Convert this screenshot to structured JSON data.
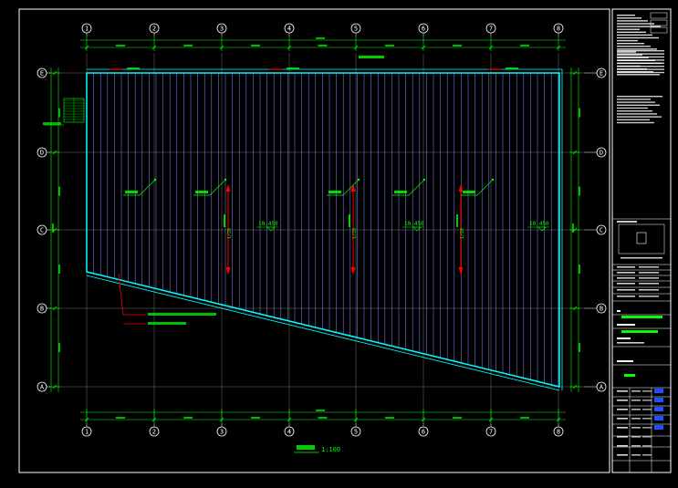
{
  "drawing": {
    "grid_columns": [
      "1",
      "2",
      "3",
      "4",
      "5",
      "6",
      "7",
      "8"
    ],
    "grid_rows": [
      "E",
      "D",
      "C",
      "B",
      "A"
    ],
    "elevations": [
      "10.450",
      "10.450",
      "10.450"
    ],
    "scale": "1:100",
    "slope_label": "1/20",
    "colors": {
      "background": "#000000",
      "border": "#ffffff",
      "dimension": "#00ff00",
      "roof_outline": "#00ffff",
      "panel": "#8080ff",
      "arrow": "#ff0000",
      "axis": "#ffffff",
      "grid": "#707070",
      "leader": "#ff0000",
      "titleblock_accent": "#00ff00",
      "titleblock_blue": "#2050ff"
    }
  }
}
